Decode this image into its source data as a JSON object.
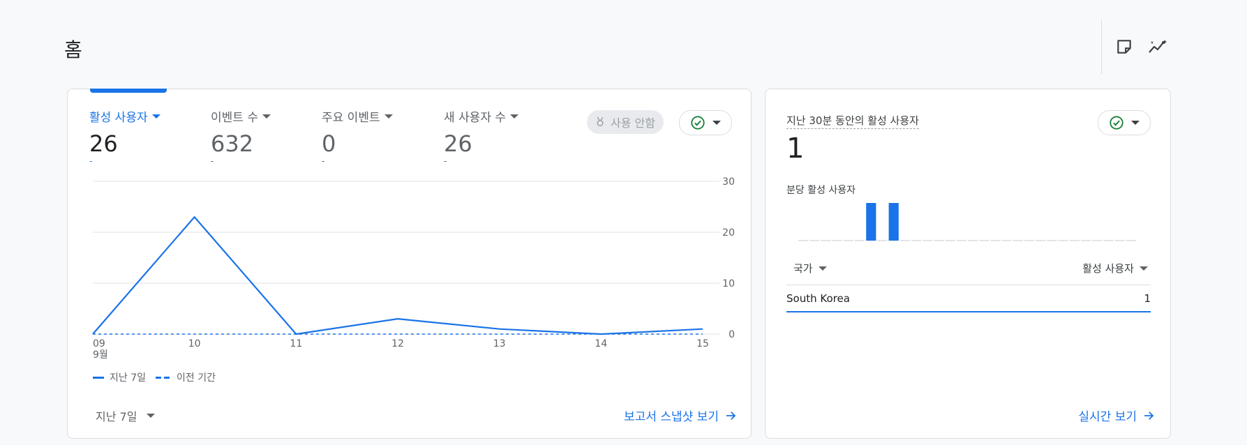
{
  "page": {
    "title": "홈"
  },
  "header_icons": [
    {
      "icon": "note-icon"
    },
    {
      "icon": "insights-icon"
    }
  ],
  "metrics": [
    {
      "label": "활성 사용자",
      "value": "26",
      "delta": "-"
    },
    {
      "label": "이벤트 수",
      "value": "632",
      "delta": "-"
    },
    {
      "label": "주요 이벤트",
      "value": "0",
      "delta": "-"
    },
    {
      "label": "새 사용자 수",
      "value": "26",
      "delta": "-"
    }
  ],
  "disabled_chip": {
    "label": "사용 안함",
    "icon": "award-icon"
  },
  "chart_data": {
    "type": "line",
    "categories": [
      "09",
      "10",
      "11",
      "12",
      "13",
      "14",
      "15"
    ],
    "month_label": "9월",
    "series": [
      {
        "name": "지난 7일",
        "values": [
          0,
          23,
          0,
          3,
          1,
          0,
          1
        ],
        "color": "#1a73e8",
        "style": "solid"
      },
      {
        "name": "이전 기간",
        "values": [
          0,
          0,
          0,
          0,
          0,
          0,
          0
        ],
        "color": "#1a73e8",
        "style": "dashed"
      }
    ],
    "y_ticks": [
      "30",
      "20",
      "10",
      "0"
    ],
    "ylim": [
      0,
      30
    ],
    "grid": true,
    "legend_position": "bottom-left"
  },
  "date_range": {
    "label": "지난 7일"
  },
  "snapshot_link": {
    "label": "보고서 스냅샷 보기"
  },
  "realtime": {
    "title": "지난 30분 동안의 활성 사용자",
    "value": "1",
    "per_minute_label": "분당 활성 사용자",
    "per_minute_values": [
      0,
      0,
      0,
      0,
      0,
      0,
      1,
      0,
      1,
      0,
      0,
      0,
      0,
      0,
      0,
      0,
      0,
      0,
      0,
      0,
      0,
      0,
      0,
      0,
      0,
      0,
      0,
      0,
      0,
      0
    ],
    "col_country": "국가",
    "col_active": "활성 사용자",
    "rows": [
      {
        "country": "South Korea",
        "value": "1"
      }
    ],
    "link": "실시간 보기"
  },
  "colors": {
    "accent": "#1a73e8",
    "status_ok": "#188038"
  }
}
